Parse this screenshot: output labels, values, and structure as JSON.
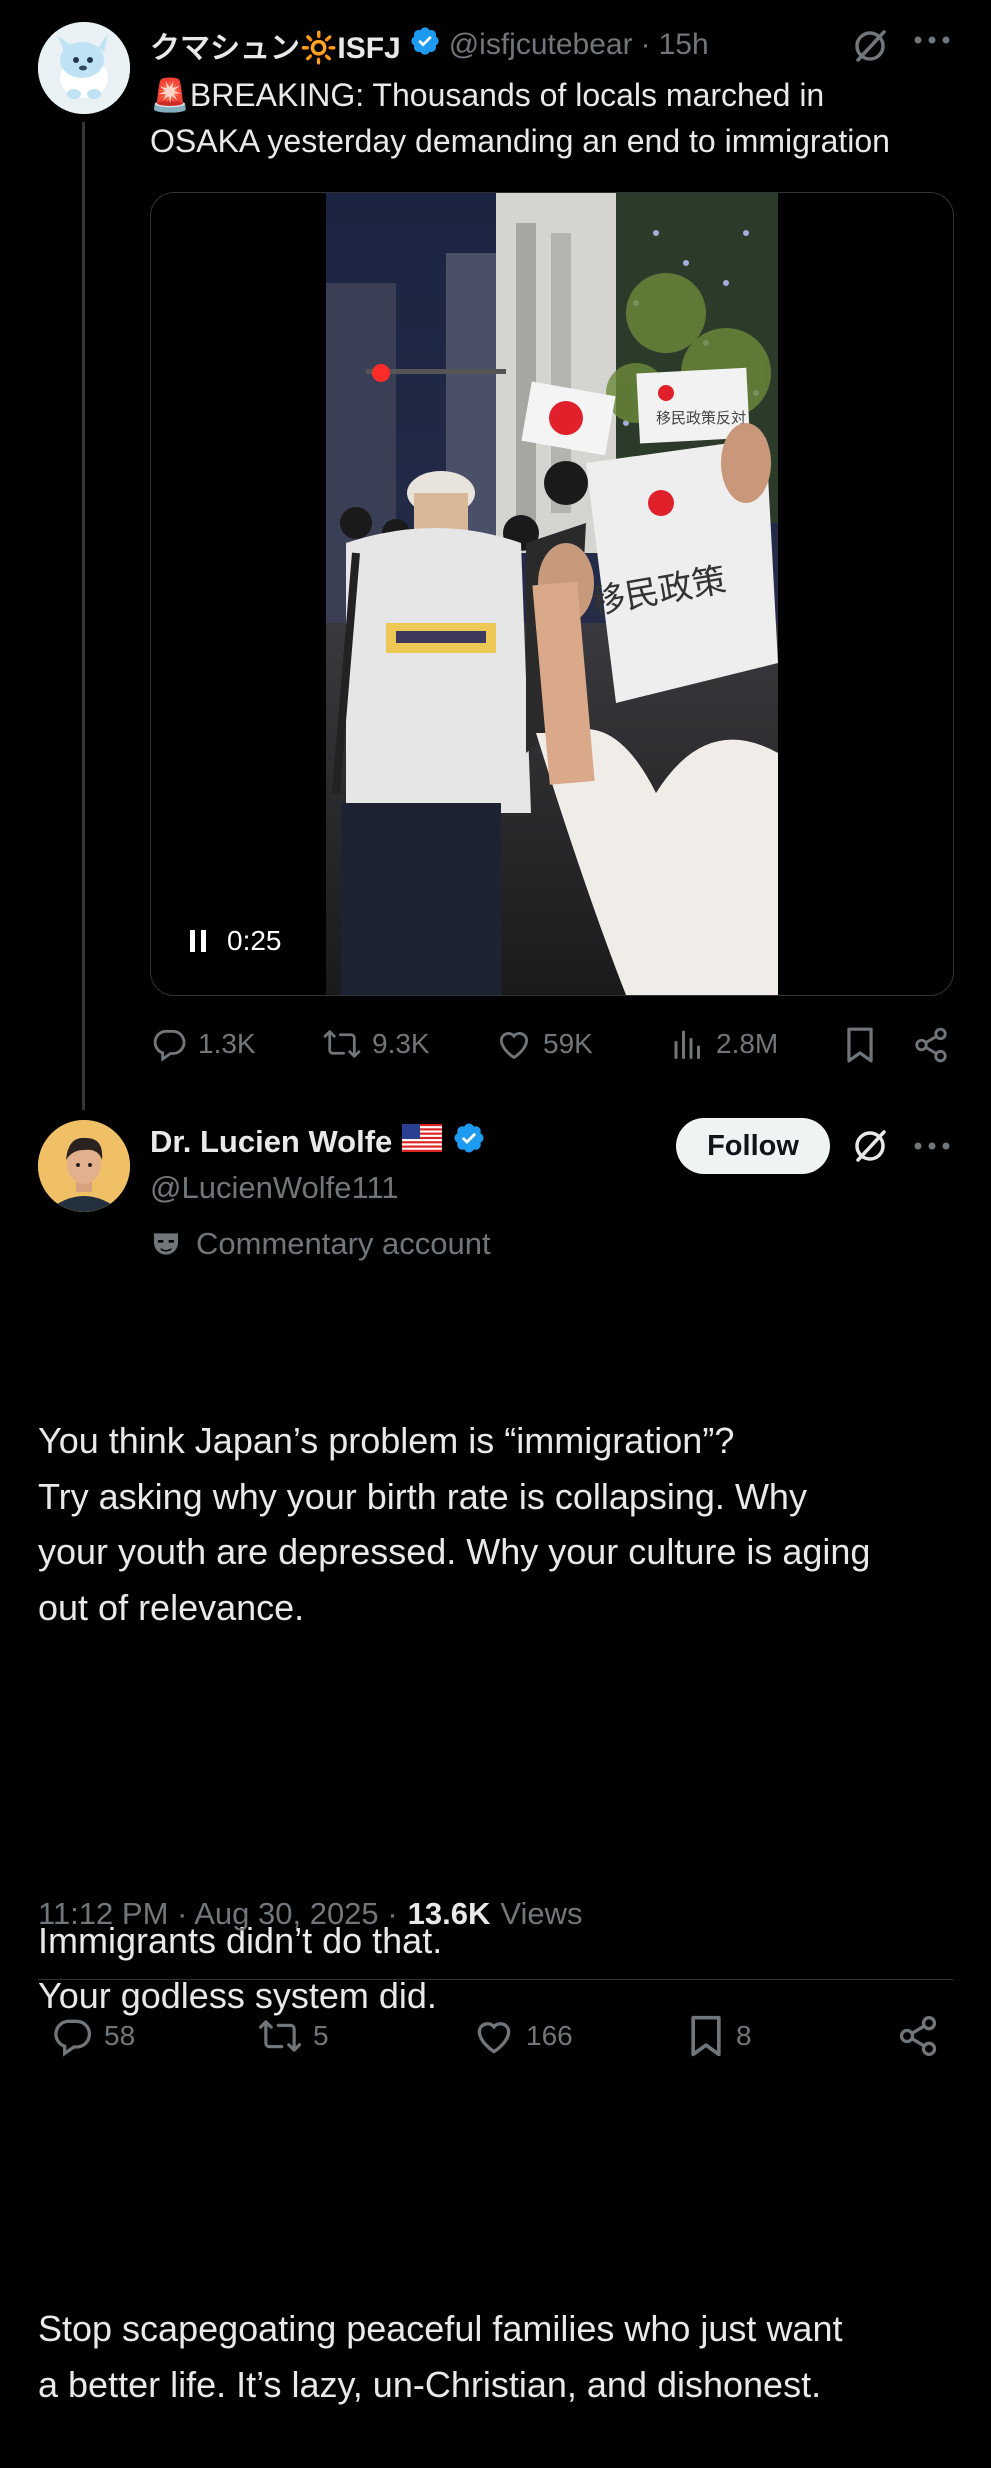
{
  "quoted_post": {
    "display_name": "クマシュン🔆ISFJ",
    "handle": "@isfjcutebear",
    "separator": "·",
    "time": "15h",
    "text_line1": "🚨BREAKING: Thousands of locals marched in",
    "text_line2": "OSAKA yesterday demanding an end to immigration",
    "video": {
      "time_label": "0:25",
      "sign_text_1": "移民政策反対",
      "sign_text_2": "移民政策"
    },
    "stats": {
      "replies": "1.3K",
      "reposts": "9.3K",
      "likes": "59K",
      "views": "2.8M"
    }
  },
  "main_post": {
    "display_name": "Dr. Lucien Wolfe",
    "flag": "🇺🇸",
    "handle": "@LucienWolfe111",
    "follow_label": "Follow",
    "label_text": "Commentary account",
    "body_p1": "You think Japan’s problem is “immigration”?\nTry asking why your birth rate is collapsing. Why\nyour youth are depressed. Why your culture is aging\nout of relevance.",
    "body_p2": "Immigrants didn’t do that.\nYour godless system did.",
    "body_p3": "Stop scapegoating peaceful families who just want\na better life. It’s lazy, un-Christian, and dishonest.",
    "timestamp": "11:12 PM · Aug 30, 2025 ·",
    "views_count": "13.6K",
    "views_label": "Views",
    "stats": {
      "replies": "58",
      "reposts": "5",
      "likes": "166",
      "bookmarks": "8"
    }
  },
  "colors": {
    "background": "#000000",
    "text": "#e7e9ea",
    "secondary": "#71767b",
    "verified": "#1d9bf0",
    "follow_bg": "#eff3f4"
  }
}
